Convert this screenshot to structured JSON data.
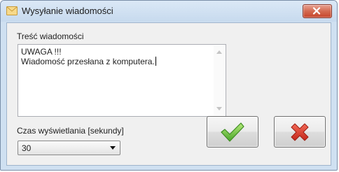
{
  "window": {
    "title": "Wysyłanie wiadomości",
    "title_icon": "envelope-icon",
    "close_icon": "close-icon"
  },
  "form": {
    "message_label": "Treść wiadomości",
    "message_lines": [
      "UWAGA !!!",
      "Wiadomość przesłana z komputera."
    ],
    "duration_label": "Czas wyświetlania [sekundy]",
    "duration_value": "30"
  },
  "buttons": {
    "ok_icon": "checkmark-icon",
    "cancel_icon": "cross-icon"
  },
  "colors": {
    "titlebar": "#c7daee",
    "close_button": "#c6452b",
    "ok_check": "#6cc23a",
    "cancel_cross": "#d63a2a"
  }
}
